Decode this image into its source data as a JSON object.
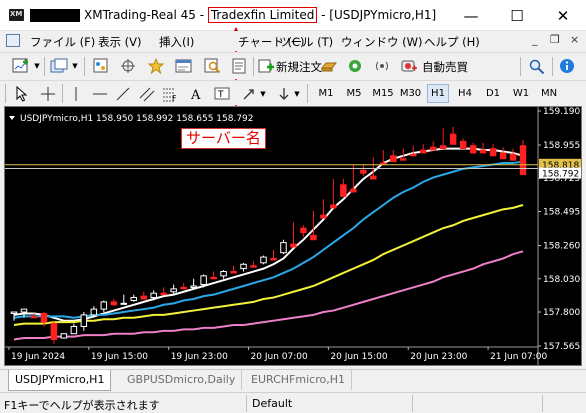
{
  "window": {
    "title_prefix": "XMTrading-Real 45 - ",
    "server_name": "Tradexfin Limited",
    "title_suffix": " - [USDJPYmicro,H1]",
    "minimize_glyph": "—",
    "maximize_glyph": "☐",
    "close_glyph": "✕"
  },
  "menu": {
    "items": [
      "ファイル (F)",
      "表示 (V)",
      "挿入(I)",
      "チャート (C)",
      "ツール (T)",
      "ウィンドウ (W)",
      "ヘルプ (H)"
    ],
    "mdi_minimize": "_",
    "mdi_restore": "❐",
    "mdi_close": "×"
  },
  "toolbar": {
    "new_order_label": "新規注文",
    "auto_trade_label": "自動売買"
  },
  "timeframes": [
    "M1",
    "M5",
    "M15",
    "M30",
    "H1",
    "H4",
    "D1",
    "W1",
    "MN"
  ],
  "active_timeframe": "H1",
  "chart": {
    "header": "USDJPYmicro,H1  158.950 158.992 158.655 158.792",
    "bid_price_label": "158.792",
    "ask_price_label": "158.818",
    "colors": {
      "background": "#000000",
      "bull": "#ffffff",
      "bear": "#ff2020",
      "ma_fast": "#ffffff",
      "ma_blue": "#29a8e8",
      "ma_yellow": "#f2f23a",
      "ma_pink": "#ee7fc8",
      "bid_line": "#c8c8c8",
      "ask_line": "#e2c14a",
      "axis_text": "#ffffff"
    }
  },
  "chart_data": {
    "type": "line",
    "title": "",
    "xlabel": "",
    "ylabel": "",
    "ylim": [
      157.565,
      159.19
    ],
    "x_ticks": [
      "19 Jun 2024",
      "19 Jun 15:00",
      "19 Jun 23:00",
      "20 Jun 07:00",
      "20 Jun 15:00",
      "20 Jun 23:00",
      "21 Jun 07:00"
    ],
    "y_ticks": [
      159.19,
      158.955,
      158.725,
      158.495,
      158.26,
      158.03,
      157.8,
      157.565
    ],
    "candles": [
      [
        157.79,
        157.8,
        157.76,
        157.74
      ],
      [
        157.8,
        157.82,
        157.78,
        157.76
      ],
      [
        157.77,
        157.76,
        157.79,
        157.79
      ],
      [
        157.79,
        157.73,
        157.8,
        157.7
      ],
      [
        157.72,
        157.61,
        157.74,
        157.58
      ],
      [
        157.62,
        157.65,
        157.63,
        157.64
      ],
      [
        157.65,
        157.7,
        157.69,
        157.72
      ],
      [
        157.7,
        157.78,
        157.67,
        157.8
      ],
      [
        157.78,
        157.82,
        157.76,
        157.84
      ],
      [
        157.82,
        157.87,
        157.8,
        157.88
      ],
      [
        157.87,
        157.85,
        157.84,
        157.89
      ],
      [
        157.86,
        157.86,
        157.9,
        157.92
      ],
      [
        157.88,
        157.9,
        157.87,
        157.92
      ],
      [
        157.91,
        157.89,
        157.92,
        157.94
      ],
      [
        157.9,
        157.93,
        157.88,
        157.95
      ],
      [
        157.93,
        157.92,
        157.95,
        157.97
      ],
      [
        157.94,
        157.96,
        157.92,
        157.99
      ],
      [
        157.97,
        157.96,
        157.98,
        158.0
      ],
      [
        157.97,
        157.98,
        158.02,
        158.03
      ],
      [
        157.99,
        158.05,
        157.97,
        158.06
      ],
      [
        158.04,
        158.03,
        158.06,
        158.08
      ],
      [
        158.05,
        158.08,
        158.03,
        158.09
      ],
      [
        158.08,
        158.07,
        158.11,
        158.12
      ],
      [
        158.1,
        158.13,
        158.08,
        158.14
      ],
      [
        158.12,
        158.11,
        158.14,
        158.15
      ],
      [
        158.14,
        158.18,
        158.13,
        158.19
      ],
      [
        158.17,
        158.16,
        158.22,
        158.23
      ],
      [
        158.21,
        158.28,
        158.2,
        158.3
      ],
      [
        158.27,
        158.25,
        158.4,
        158.42
      ],
      [
        158.38,
        158.35,
        158.32,
        158.4
      ],
      [
        158.33,
        158.3,
        158.48,
        158.5
      ],
      [
        158.47,
        158.45,
        158.55,
        158.58
      ],
      [
        158.54,
        158.52,
        158.7,
        158.72
      ],
      [
        158.68,
        158.6,
        158.66,
        158.72
      ],
      [
        158.65,
        158.63,
        158.8,
        158.82
      ],
      [
        158.78,
        158.76,
        158.74,
        158.82
      ],
      [
        158.74,
        158.72,
        158.84,
        158.87
      ],
      [
        158.83,
        158.82,
        158.9,
        158.92
      ],
      [
        158.88,
        158.84,
        158.86,
        158.92
      ],
      [
        158.86,
        158.85,
        158.9,
        158.93
      ],
      [
        158.89,
        158.88,
        158.93,
        158.95
      ],
      [
        158.92,
        158.9,
        158.94,
        158.96
      ],
      [
        158.94,
        158.92,
        158.96,
        158.98
      ],
      [
        158.95,
        158.93,
        159.05,
        159.07
      ],
      [
        159.03,
        158.96,
        158.98,
        159.08
      ],
      [
        158.98,
        158.93,
        158.95,
        159.0
      ],
      [
        158.95,
        158.9,
        158.93,
        158.97
      ],
      [
        158.92,
        158.9,
        158.95,
        158.97
      ],
      [
        158.93,
        158.88,
        158.9,
        158.96
      ],
      [
        158.9,
        158.86,
        158.88,
        158.94
      ],
      [
        158.89,
        158.85,
        158.87,
        158.93
      ],
      [
        158.95,
        158.75,
        158.79,
        158.99
      ]
    ],
    "series": [
      {
        "values": [
          157.78,
          157.79,
          157.79,
          157.78,
          157.76,
          157.74,
          157.74,
          157.75,
          157.77,
          157.79,
          157.81,
          157.83,
          157.85,
          157.87,
          157.89,
          157.91,
          157.92,
          157.94,
          157.96,
          157.98,
          158.0,
          158.02,
          158.04,
          158.06,
          158.08,
          158.1,
          158.13,
          158.17,
          158.24,
          158.3,
          158.37,
          158.44,
          158.52,
          158.58,
          158.65,
          158.72,
          158.77,
          158.83,
          158.86,
          158.88,
          158.9,
          158.91,
          158.92,
          158.93,
          158.93,
          158.93,
          158.93,
          158.92,
          158.92,
          158.91,
          158.9,
          158.88
        ]
      },
      {
        "values": [
          157.76,
          157.77,
          157.77,
          157.77,
          157.77,
          157.77,
          157.76,
          157.77,
          157.78,
          157.78,
          157.79,
          157.8,
          157.81,
          157.82,
          157.83,
          157.85,
          157.86,
          157.88,
          157.89,
          157.91,
          157.92,
          157.94,
          157.96,
          157.98,
          158.0,
          158.02,
          158.04,
          158.07,
          158.1,
          158.14,
          158.18,
          158.23,
          158.28,
          158.33,
          158.38,
          158.44,
          158.49,
          158.54,
          158.59,
          158.63,
          158.66,
          158.7,
          158.73,
          158.75,
          158.77,
          158.79,
          158.8,
          158.81,
          158.82,
          158.83,
          158.83,
          158.84
        ]
      },
      {
        "values": [
          157.71,
          157.72,
          157.72,
          157.72,
          157.73,
          157.73,
          157.73,
          157.74,
          157.74,
          157.75,
          157.75,
          157.76,
          157.76,
          157.77,
          157.78,
          157.78,
          157.79,
          157.8,
          157.81,
          157.82,
          157.83,
          157.84,
          157.85,
          157.86,
          157.87,
          157.89,
          157.9,
          157.92,
          157.94,
          157.96,
          157.98,
          158.01,
          158.04,
          158.07,
          158.1,
          158.13,
          158.16,
          158.2,
          158.23,
          158.26,
          158.29,
          158.32,
          158.35,
          158.38,
          158.4,
          158.43,
          158.45,
          158.47,
          158.49,
          158.51,
          158.52,
          158.54
        ]
      },
      {
        "values": [
          157.61,
          157.62,
          157.62,
          157.62,
          157.63,
          157.63,
          157.63,
          157.64,
          157.64,
          157.64,
          157.65,
          157.65,
          157.65,
          157.66,
          157.66,
          157.67,
          157.67,
          157.68,
          157.68,
          157.69,
          157.69,
          157.7,
          157.71,
          157.71,
          157.72,
          157.73,
          157.74,
          157.75,
          157.76,
          157.77,
          157.78,
          157.8,
          157.81,
          157.83,
          157.85,
          157.87,
          157.89,
          157.91,
          157.93,
          157.95,
          157.97,
          157.99,
          158.01,
          158.04,
          158.06,
          158.08,
          158.1,
          158.13,
          158.15,
          158.17,
          158.2,
          158.22
        ]
      }
    ]
  },
  "tabs": [
    "USDJPYmicro,H1",
    "GBPUSDmicro,Daily",
    "EURCHFmicro,H1"
  ],
  "active_tab": "USDJPYmicro,H1",
  "status": {
    "help_text": "F1キーでヘルプが表示されます",
    "profile": "Default"
  },
  "annotation": {
    "label": "サーバー名",
    "color": "#e00000"
  }
}
